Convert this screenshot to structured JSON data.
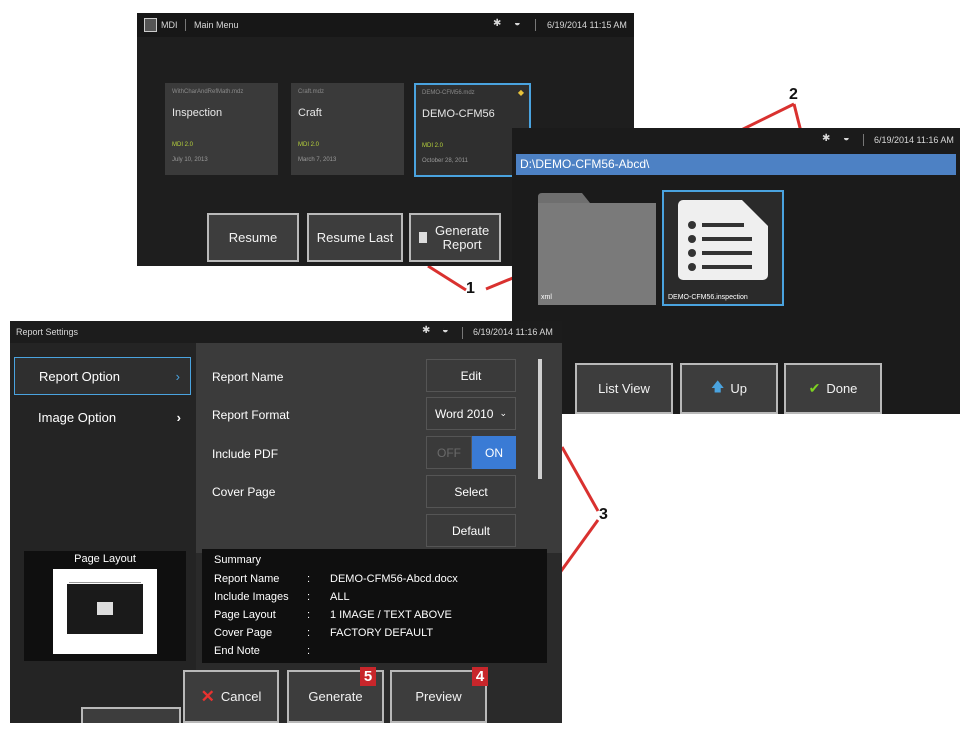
{
  "screen_main": {
    "app": "MDI",
    "title": "Main Menu",
    "datetime": "6/19/2014 11:15 AM",
    "cards": [
      {
        "file": "WithCharAndRefMath.mdz",
        "title": "Inspection",
        "version": "MDI 2.0",
        "date": "July 10, 2013"
      },
      {
        "file": "Craft.mdz",
        "title": "Craft",
        "version": "MDI 2.0",
        "date": "March 7, 2013"
      },
      {
        "file": "DEMO-CFM56.mdz",
        "title": "DEMO-CFM56",
        "version": "MDI 2.0",
        "date": "October 28, 2011"
      }
    ],
    "buttons": {
      "resume": "Resume",
      "resume_last": "Resume Last",
      "generate_line1": "Generate",
      "generate_line2": "Report"
    }
  },
  "screen_files": {
    "datetime": "6/19/2014 11:16 AM",
    "path": "D:\\DEMO-CFM56-Abcd\\",
    "items": [
      {
        "name": "xml",
        "icon": "folder-icon"
      },
      {
        "name": "DEMO-CFM56.inspection",
        "icon": "inspection-file-icon"
      }
    ],
    "buttons": {
      "list_view": "List View",
      "up": "Up",
      "done": "Done"
    }
  },
  "screen_report": {
    "title": "Report Settings",
    "datetime": "6/19/2014 11:16 AM",
    "sidebar": [
      {
        "label": "Report Option",
        "active": true
      },
      {
        "label": "Image Option",
        "active": false
      }
    ],
    "page_layout_label": "Page Layout",
    "rows": {
      "report_name": {
        "label": "Report Name",
        "control": "Edit"
      },
      "report_format": {
        "label": "Report Format",
        "control": "Word 2010"
      },
      "include_pdf": {
        "label": "Include PDF",
        "off": "OFF",
        "on": "ON",
        "value": "ON"
      },
      "cover_page": {
        "label": "Cover Page",
        "control": "Select",
        "default": "Default"
      }
    },
    "summary": {
      "heading": "Summary",
      "items": [
        {
          "key": "Report Name",
          "value": "DEMO-CFM56-Abcd.docx"
        },
        {
          "key": "Include Images",
          "value": "ALL"
        },
        {
          "key": "Page Layout",
          "value": "1 IMAGE / TEXT ABOVE"
        },
        {
          "key": "Cover Page",
          "value": "FACTORY DEFAULT"
        },
        {
          "key": "End Note",
          "value": ""
        }
      ]
    },
    "buttons": {
      "cancel": "Cancel",
      "generate": "Generate",
      "preview": "Preview"
    }
  },
  "callouts": {
    "c1": "1",
    "c2": "2",
    "c3": "3",
    "c4": "4",
    "c5": "5"
  },
  "colors": {
    "accent_blue": "#4d81c4",
    "highlight_border": "#4aa3df",
    "callout_red": "#c8262b",
    "pdf_on": "#3a7bd5"
  }
}
